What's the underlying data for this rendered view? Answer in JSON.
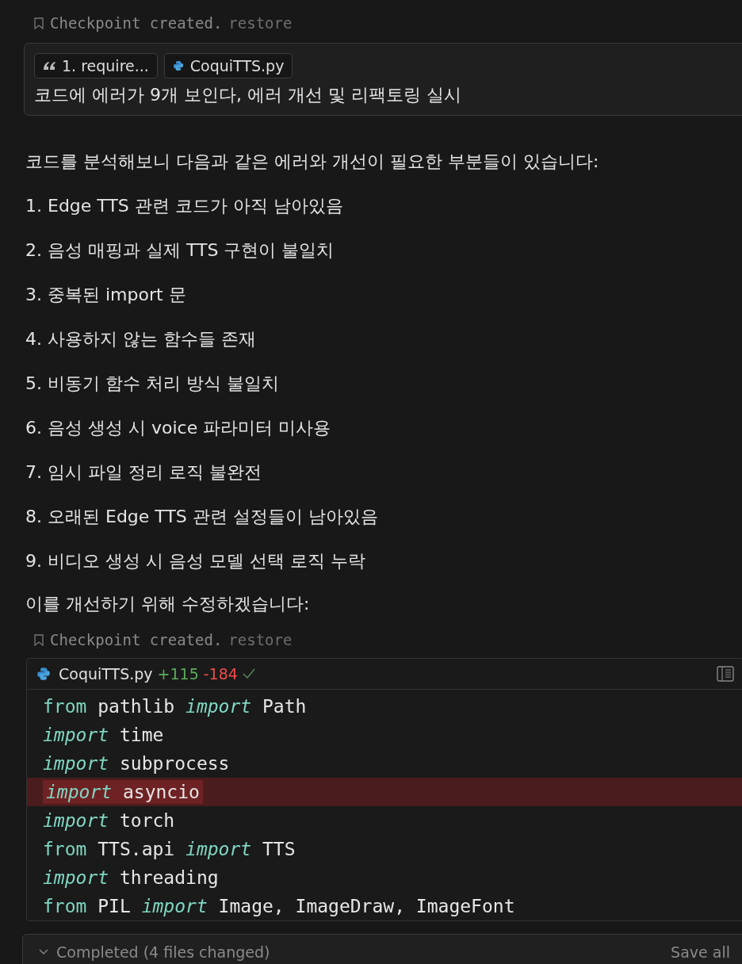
{
  "checkpoint_top": {
    "text": "Checkpoint created.",
    "action": "restore"
  },
  "user_message": {
    "chips": [
      {
        "kind": "quote",
        "label": "1. require..."
      },
      {
        "kind": "python",
        "label": "CoquiTTS.py"
      }
    ],
    "text": "코드에 에러가 9개 보인다, 에러 개선 및 리팩토링 실시"
  },
  "response": {
    "intro": "코드를 분석해보니 다음과 같은 에러와 개선이 필요한 부분들이 있습니다:",
    "items": [
      "1. Edge TTS 관련 코드가 아직 남아있음",
      "2. 음성 매핑과 실제 TTS 구현이 불일치",
      "3. 중복된 import 문",
      "4. 사용하지 않는 함수들 존재",
      "5. 비동기 함수 처리 방식 불일치",
      "6. 음성 생성 시 voice 파라미터 미사용",
      "7. 임시 파일 정리 로직 불완전",
      "8. 오래된 Edge TTS 관련 설정들이 남아있음",
      "9. 비디오 생성 시 음성 모델 선택 로직 누락"
    ],
    "outro": "이를 개선하기 위해 수정하겠습니다:"
  },
  "checkpoint_bottom": {
    "text": "Checkpoint created.",
    "action": "restore"
  },
  "code_block": {
    "file": "CoquiTTS.py",
    "added": "+115",
    "removed": "-184",
    "applied": true,
    "lines": [
      {
        "deleted": false,
        "tokens": [
          {
            "kind": "keyword",
            "text": "from"
          },
          {
            "kind": "plain",
            "text": "pathlib"
          },
          {
            "kind": "italic",
            "text": "import"
          },
          {
            "kind": "plain",
            "text": "Path"
          }
        ]
      },
      {
        "deleted": false,
        "tokens": [
          {
            "kind": "italic",
            "text": "import"
          },
          {
            "kind": "plain",
            "text": "time"
          }
        ]
      },
      {
        "deleted": false,
        "tokens": [
          {
            "kind": "italic",
            "text": "import"
          },
          {
            "kind": "plain",
            "text": "subprocess"
          }
        ]
      },
      {
        "deleted": true,
        "tokens": [
          {
            "kind": "italic",
            "text": "import"
          },
          {
            "kind": "plain",
            "text": "asyncio"
          }
        ]
      },
      {
        "deleted": false,
        "tokens": [
          {
            "kind": "italic",
            "text": "import"
          },
          {
            "kind": "plain",
            "text": "torch"
          }
        ]
      },
      {
        "deleted": false,
        "tokens": [
          {
            "kind": "keyword",
            "text": "from"
          },
          {
            "kind": "plain",
            "text": "TTS.api"
          },
          {
            "kind": "italic",
            "text": "import"
          },
          {
            "kind": "plain",
            "text": "TTS"
          }
        ]
      },
      {
        "deleted": false,
        "tokens": [
          {
            "kind": "italic",
            "text": "import"
          },
          {
            "kind": "plain",
            "text": "threading"
          }
        ]
      },
      {
        "deleted": false,
        "tokens": [
          {
            "kind": "keyword",
            "text": "from"
          },
          {
            "kind": "plain",
            "text": "PIL"
          },
          {
            "kind": "italic",
            "text": "import"
          },
          {
            "kind": "plain",
            "text": "Image, ImageDraw, ImageFont"
          }
        ]
      }
    ]
  },
  "status_bar": {
    "text": "Completed (4 files changed)",
    "action": "Save all"
  }
}
